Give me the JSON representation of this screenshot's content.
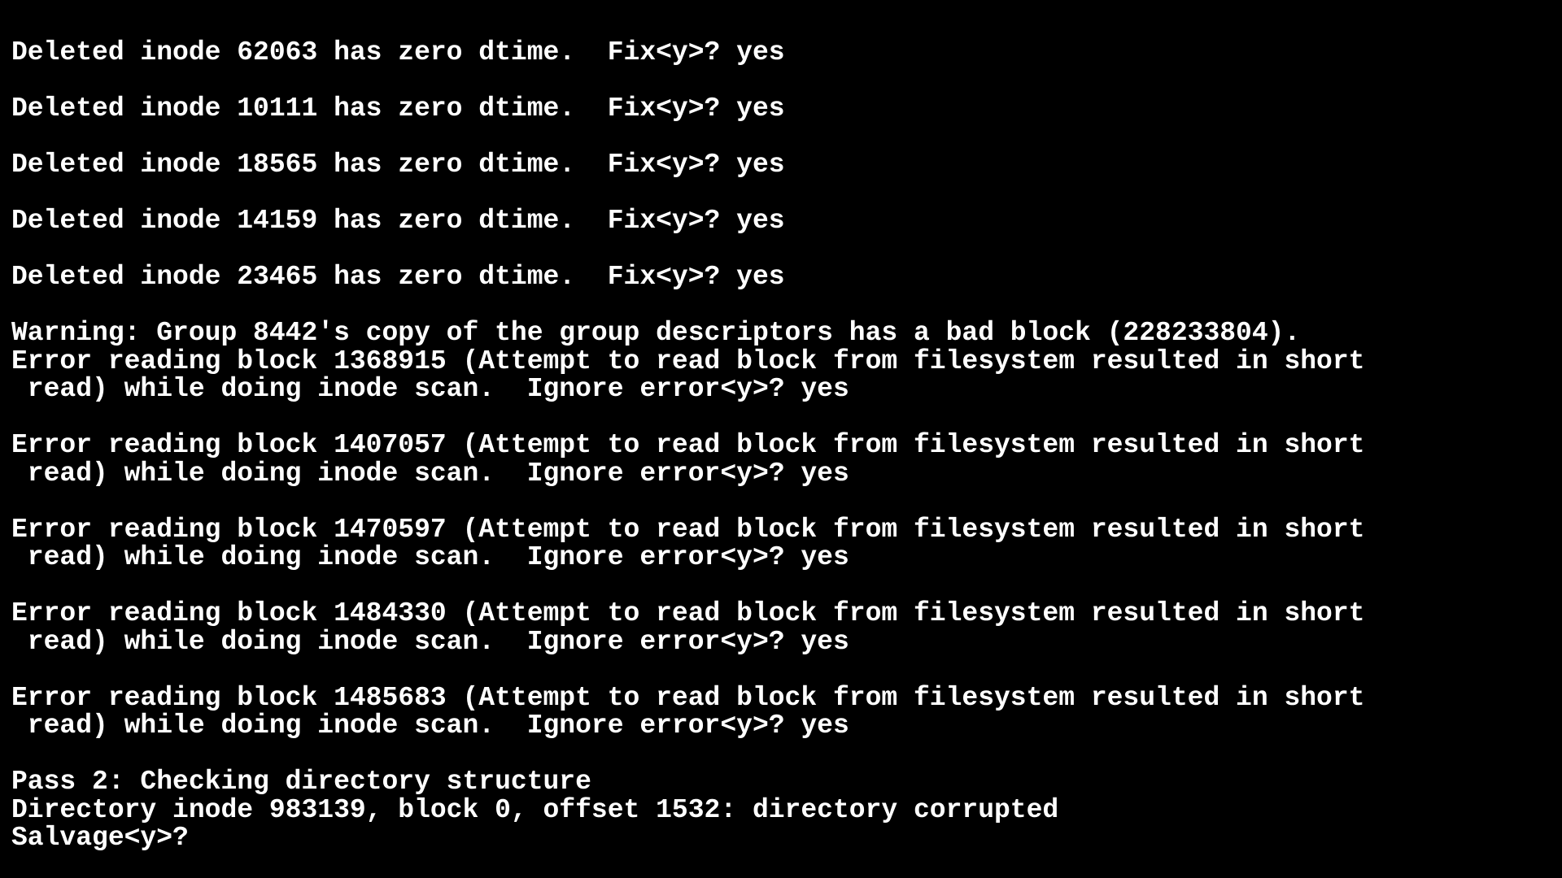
{
  "terminal": {
    "lines": [
      "Deleted inode 62063 has zero dtime.  Fix<y>? yes",
      "",
      "Deleted inode 10111 has zero dtime.  Fix<y>? yes",
      "",
      "Deleted inode 18565 has zero dtime.  Fix<y>? yes",
      "",
      "Deleted inode 14159 has zero dtime.  Fix<y>? yes",
      "",
      "Deleted inode 23465 has zero dtime.  Fix<y>? yes",
      "",
      "Warning: Group 8442's copy of the group descriptors has a bad block (228233804).",
      "Error reading block 1368915 (Attempt to read block from filesystem resulted in short",
      " read) while doing inode scan.  Ignore error<y>? yes",
      "",
      "Error reading block 1407057 (Attempt to read block from filesystem resulted in short",
      " read) while doing inode scan.  Ignore error<y>? yes",
      "",
      "Error reading block 1470597 (Attempt to read block from filesystem resulted in short",
      " read) while doing inode scan.  Ignore error<y>? yes",
      "",
      "Error reading block 1484330 (Attempt to read block from filesystem resulted in short",
      " read) while doing inode scan.  Ignore error<y>? yes",
      "",
      "Error reading block 1485683 (Attempt to read block from filesystem resulted in short",
      " read) while doing inode scan.  Ignore error<y>? yes",
      "",
      "Pass 2: Checking directory structure",
      "Directory inode 983139, block 0, offset 1532: directory corrupted",
      "Salvage<y>? "
    ],
    "colors": {
      "background": "#000000",
      "foreground": "#ffffff"
    }
  }
}
